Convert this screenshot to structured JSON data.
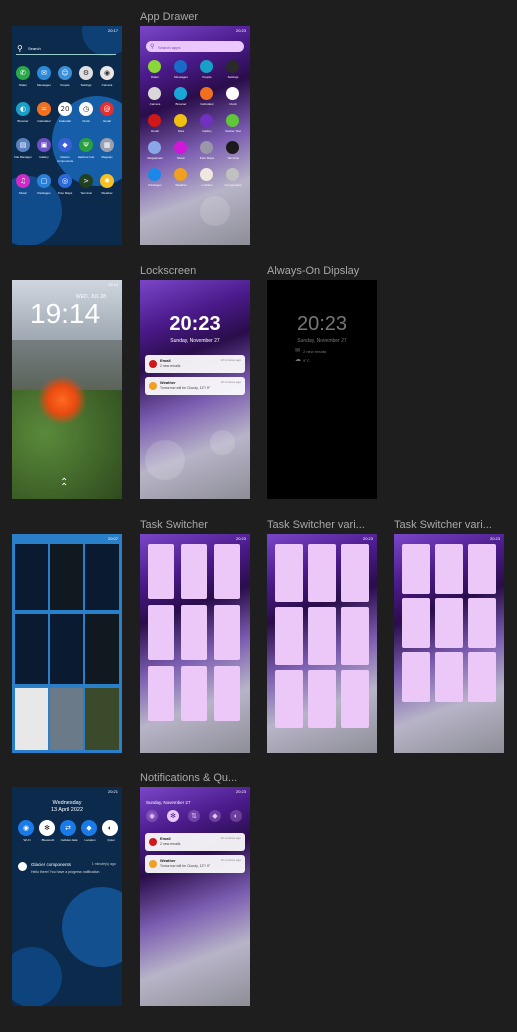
{
  "frames": {
    "app_drawer": "App Drawer",
    "lockscreen": "Lockscreen",
    "aod": "Always-On Dipslay",
    "task_switcher": "Task Switcher",
    "task_switcher_var1": "Task Switcher vari...",
    "task_switcher_var2": "Task Switcher vari...",
    "notifications": "Notifications & Qu..."
  },
  "ref_home": {
    "time": "20:17",
    "search": "Search",
    "apps": [
      "Dialer",
      "Messages",
      "People",
      "Settings",
      "Camera",
      "Browser",
      "Calculator",
      "Calendar",
      "Clock",
      "Email",
      "File Manager",
      "Gallery",
      "Glacier components",
      "Harbour test",
      "Megapix",
      "Music",
      "Packages",
      "Pure Maps",
      "Terminal",
      "Weather"
    ]
  },
  "app_drawer": {
    "time": "20:23",
    "search_placeholder": "Search apps",
    "apps": [
      "Dialer",
      "Messages",
      "People",
      "Settings",
      "Camera",
      "Browser",
      "Calculator",
      "Clock",
      "Email",
      "Files",
      "Gallery",
      "Glacier Test",
      "Megapixels",
      "Music",
      "Pure Maps",
      "Terminal",
      "Packages",
      "Weather",
      "Lockbox",
      "Components"
    ]
  },
  "ref_lock": {
    "time": "19:14",
    "date": "WED, JUL 28",
    "status_time": "19:14"
  },
  "lockscreen": {
    "time": "20:23",
    "date": "Sunday, November 27",
    "n1_title": "Email",
    "n1_body": "2 new emails",
    "n1_ago": "10 minutes ago",
    "n2_title": "Weather",
    "n2_body": "Tomorrow will be Cloudy, 13°/ 9°",
    "n2_ago": "10 minutes ago"
  },
  "aod": {
    "time": "20:23",
    "date": "Sunday, November 27",
    "line1": "2 new emails",
    "line2": "9°C"
  },
  "ref_switcher": {
    "time": "20:07"
  },
  "ts": {
    "time": "20:23"
  },
  "ref_notif": {
    "time": "20:21",
    "day": "Wednesday",
    "date": "13 April 2022",
    "toggles": [
      "Wi-Fi",
      "Bluetooth",
      "Cellular data",
      "Location",
      "Quiet"
    ],
    "n_title": "Glacier components",
    "n_ago": "1 minute(s) ago",
    "n_body": "Hello there! You have a progress notification"
  },
  "notifications": {
    "time": "20:23",
    "date": "Sunday, November 27",
    "n1_title": "Email",
    "n1_body": "2 new emails",
    "n1_ago": "10 minutes ago",
    "n2_title": "Weather",
    "n2_body": "Tomorrow will be Cloudy, 13°/ 9°",
    "n2_ago": "10 minutes ago"
  },
  "colors": {
    "bg": "#1e1e1e",
    "card": "#ebc8f8",
    "accent": "#eac8ff",
    "home_bg": "#0b2a4c"
  }
}
